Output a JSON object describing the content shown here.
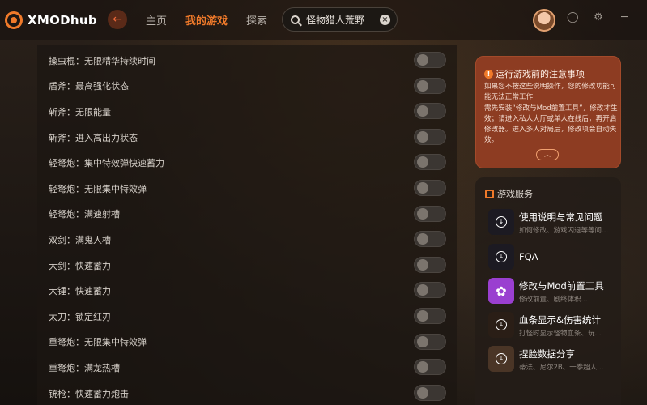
{
  "app": {
    "name": "XMODhub"
  },
  "nav": {
    "back_glyph": "←",
    "items": [
      "主页",
      "我的游戏",
      "探索"
    ],
    "active_index": 1
  },
  "search": {
    "value": "怪物猎人荒野"
  },
  "window_controls": [
    "support-icon",
    "settings-icon",
    "minimize-icon",
    "close-icon"
  ],
  "mods": [
    {
      "label": "操虫棍：无限精华持续时间",
      "enabled": false
    },
    {
      "label": "盾斧：最高强化状态",
      "enabled": false
    },
    {
      "label": "斩斧：无限能量",
      "enabled": false
    },
    {
      "label": "斩斧：进入高出力状态",
      "enabled": false
    },
    {
      "label": "轻弩炮：集中特效弹快速蓄力",
      "enabled": false
    },
    {
      "label": "轻弩炮：无限集中特效弹",
      "enabled": false
    },
    {
      "label": "轻弩炮：满速射槽",
      "enabled": false
    },
    {
      "label": "双剑：满鬼人槽",
      "enabled": false
    },
    {
      "label": "大剑：快速蓄力",
      "enabled": false
    },
    {
      "label": "大锤：快速蓄力",
      "enabled": false
    },
    {
      "label": "太刀：锁定红刃",
      "enabled": false
    },
    {
      "label": "重弩炮：无限集中特效弹",
      "enabled": false
    },
    {
      "label": "重弩炮：满龙热槽",
      "enabled": false
    },
    {
      "label": "铳枪：快速蓄力炮击",
      "enabled": false
    }
  ],
  "notice": {
    "title": "运行游戏前的注意事项",
    "body": "如果您不按这些说明操作，您的修改功能可能无法正常工作\n需先安装“修改与Mod前置工具”，修改才生效；请进入私人大厅或单人在线后，再开启修改器。进入多人对局后，修改项会自动失效。",
    "collapse_glyph": "︿"
  },
  "services": {
    "title": "游戏服务",
    "items": [
      {
        "title": "使用说明与常见问题",
        "subtitle": "如何修改、游戏闪退等等问...",
        "icon": "download-icon",
        "color": "#1c1a22"
      },
      {
        "title": "FQA",
        "subtitle": "",
        "icon": "download-icon",
        "color": "#1c1a22"
      },
      {
        "title": "修改与Mod前置工具",
        "subtitle": "修改前置、剧终体积...",
        "icon": "flower-icon",
        "color": "#9a3fd0"
      },
      {
        "title": "血条显示&伤害统计",
        "subtitle": "打怪时显示怪物血条、玩...",
        "icon": "download-icon",
        "color": "#2a1e16"
      },
      {
        "title": "捏脸数据分享",
        "subtitle": "蒂法、尼尔2B、一拳超人...",
        "icon": "download-icon",
        "color": "#4a3526"
      }
    ]
  },
  "colors": {
    "accent": "#f07a2a",
    "notice_bg": "#8d3c22"
  }
}
